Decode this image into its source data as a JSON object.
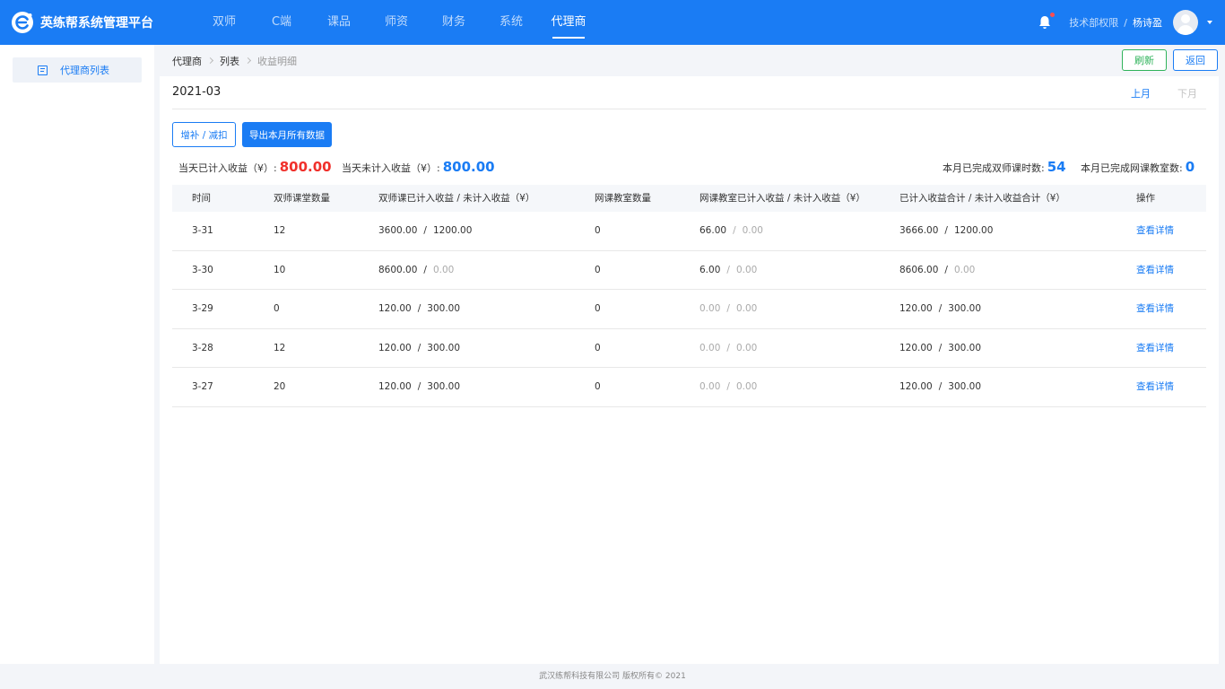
{
  "app": {
    "title": "英练帮系统管理平台"
  },
  "colors": {
    "primary": "#1a7cf4",
    "danger": "#f0302b",
    "success": "#2fb35a"
  },
  "topnav": [
    {
      "label": "双师",
      "active": false
    },
    {
      "label": "C端",
      "active": false
    },
    {
      "label": "课品",
      "active": false
    },
    {
      "label": "师资",
      "active": false
    },
    {
      "label": "财务",
      "active": false
    },
    {
      "label": "系统",
      "active": false
    },
    {
      "label": "代理商",
      "active": true
    }
  ],
  "user": {
    "dept": "技术部权限",
    "separator": "/",
    "name": "杨诗盈",
    "icons": [
      "bell-icon",
      "avatar",
      "chevron-down-icon"
    ]
  },
  "sidebar": {
    "items": [
      {
        "label": "代理商列表",
        "icon": "list-icon",
        "active": true
      }
    ]
  },
  "breadcrumb": [
    "代理商",
    "列表",
    "收益明细"
  ],
  "actions": {
    "refresh": "刷新",
    "back": "返回"
  },
  "month": {
    "title": "2021-03",
    "prev": "上月",
    "next": "下月"
  },
  "buttons": {
    "adjust": "增补 / 减扣",
    "export": "导出本月所有数据"
  },
  "stats": {
    "today_counted_label": "当天已计入收益（¥）:",
    "today_counted_value": "800.00",
    "today_uncounted_label": "当天未计入收益（¥）:",
    "today_uncounted_value": "800.00",
    "month_dual_hours_label": "本月已完成双师课时数:",
    "month_dual_hours_value": "54",
    "month_online_rooms_label": "本月已完成网课教室数:",
    "month_online_rooms_value": "0"
  },
  "table": {
    "columns": [
      "时间",
      "双师课堂数量",
      "双师课已计入收益 / 未计入收益（¥）",
      "网课教室数量",
      "网课教室已计入收益 / 未计入收益（¥）",
      "已计入收益合计 / 未计入收益合计（¥）",
      "操作"
    ],
    "action_label": "查看详情",
    "rows": [
      {
        "date": "3-31",
        "dual_count": "12",
        "dual_in": "3600.00",
        "dual_out": "1200.00",
        "online_count": "0",
        "online_in": "66.00",
        "online_out": "0.00",
        "total_in": "3666.00",
        "total_out": "1200.00",
        "action": "查看详情"
      },
      {
        "date": "3-30",
        "dual_count": "10",
        "dual_in": "8600.00",
        "dual_out": "0.00",
        "online_count": "0",
        "online_in": "6.00",
        "online_out": "0.00",
        "total_in": "8606.00",
        "total_out": "0.00",
        "action": "查看详情"
      },
      {
        "date": "3-29",
        "dual_count": "0",
        "dual_in": "120.00",
        "dual_out": "300.00",
        "online_count": "0",
        "online_in": "0.00",
        "online_out": "0.00",
        "total_in": "120.00",
        "total_out": "300.00",
        "action": "查看详情"
      },
      {
        "date": "3-28",
        "dual_count": "12",
        "dual_in": "120.00",
        "dual_out": "300.00",
        "online_count": "0",
        "online_in": "0.00",
        "online_out": "0.00",
        "total_in": "120.00",
        "total_out": "300.00",
        "action": "查看详情"
      },
      {
        "date": "3-27",
        "dual_count": "20",
        "dual_in": "120.00",
        "dual_out": "300.00",
        "online_count": "0",
        "online_in": "0.00",
        "online_out": "0.00",
        "total_in": "120.00",
        "total_out": "300.00",
        "action": "查看详情"
      }
    ]
  },
  "footer": {
    "text": "武汉练帮科技有限公司 版权所有© 2021"
  }
}
